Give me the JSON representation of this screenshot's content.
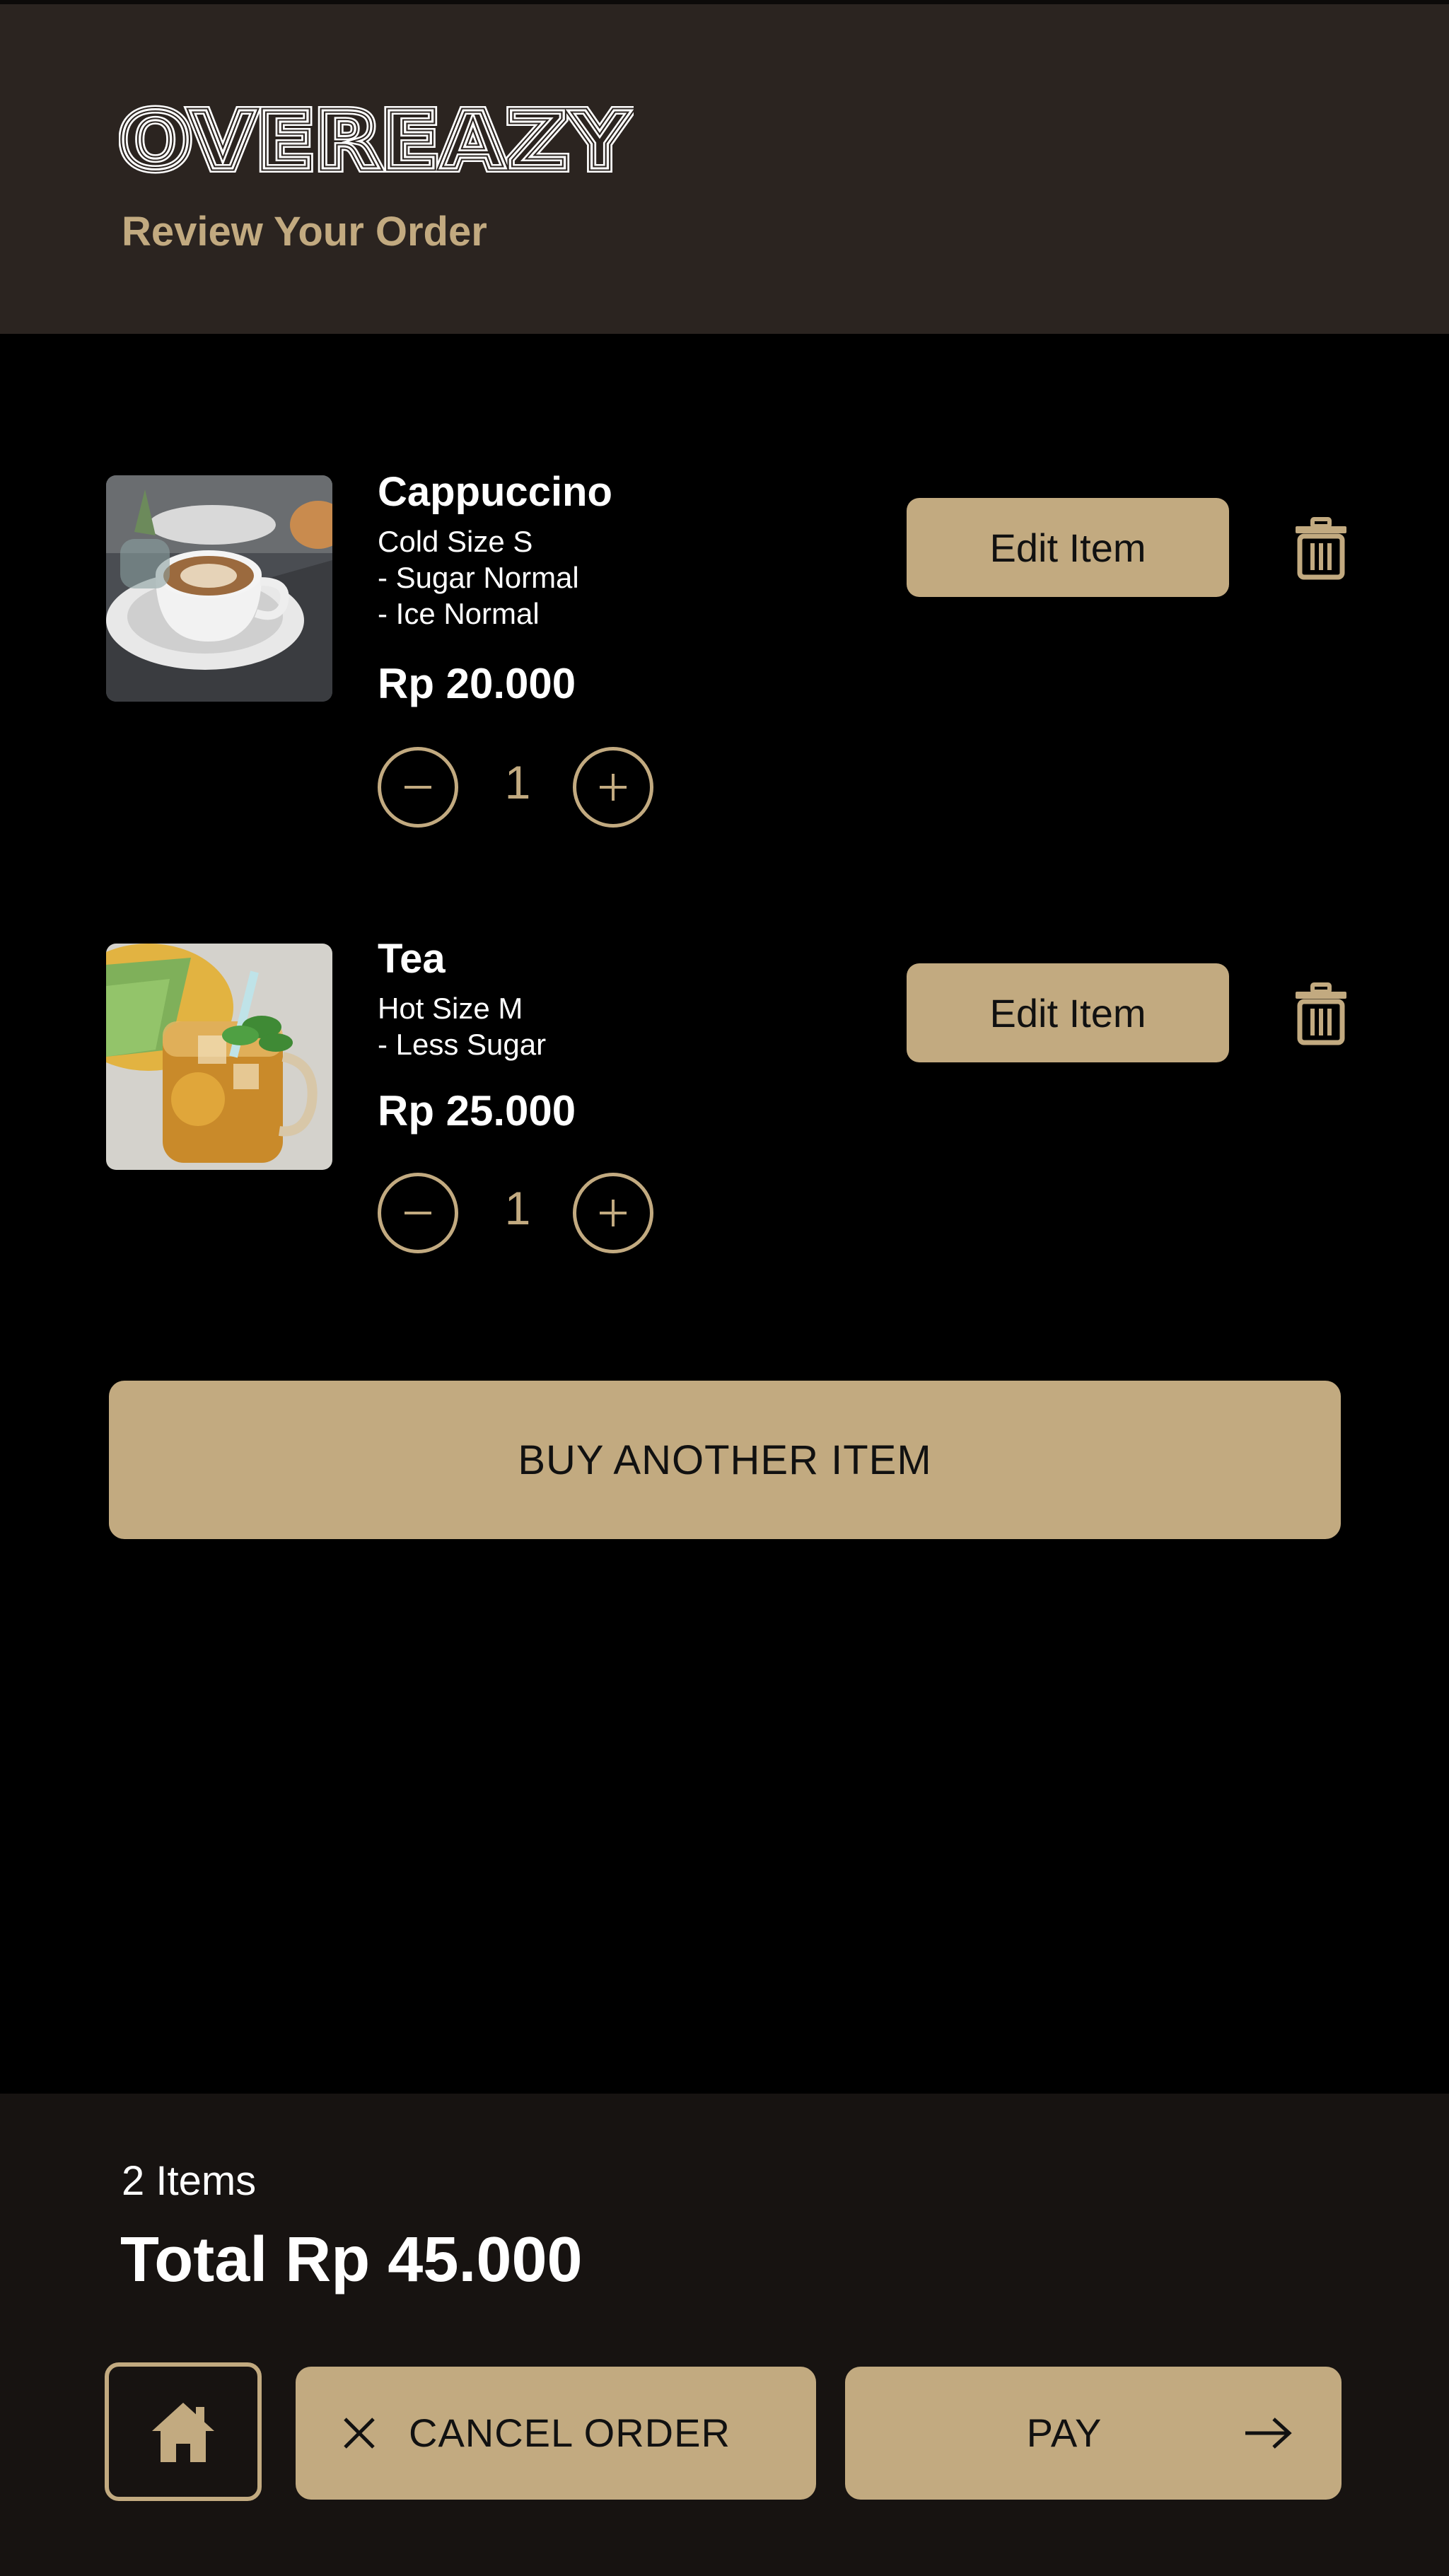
{
  "header": {
    "brand": "OVEREAZY",
    "subtitle": "Review Your Order"
  },
  "colors": {
    "accent": "#c2aa80",
    "header_bg": "#2b2420",
    "footer_bg": "#171311",
    "body_bg": "#000000"
  },
  "items": [
    {
      "name": "Cappuccino",
      "details": [
        "Cold Size S",
        "- Sugar Normal",
        "- Ice Normal"
      ],
      "price": "Rp 20.000",
      "quantity": "1",
      "edit_label": "Edit Item",
      "image": "cappuccino-photo"
    },
    {
      "name": "Tea",
      "details": [
        "Hot Size M",
        "- Less Sugar"
      ],
      "price": "Rp 25.000",
      "quantity": "1",
      "edit_label": "Edit Item",
      "image": "iced-tea-photo"
    }
  ],
  "buy_another_label": "BUY ANOTHER ITEM",
  "footer": {
    "items_count": "2 Items",
    "total": "Total Rp 45.000",
    "cancel_label": "CANCEL ORDER",
    "pay_label": "PAY"
  },
  "icons": {
    "minus": "minus-icon",
    "plus": "plus-icon",
    "trash": "trash-icon",
    "home": "home-icon",
    "close": "close-icon",
    "arrow": "arrow-right-icon"
  }
}
